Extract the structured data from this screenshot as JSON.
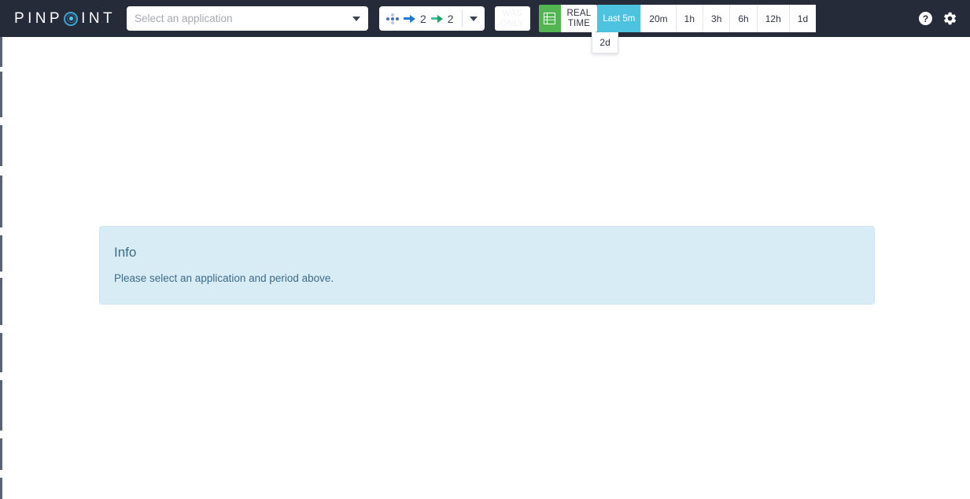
{
  "header": {
    "brand": {
      "prefix": "PINP",
      "o_icon": "pinpoint-target-icon",
      "suffix": "INT"
    },
    "app_select": {
      "placeholder": "Select an application",
      "value": "",
      "caret_icon": "caret-down-icon"
    },
    "node_summary": {
      "nodes_icon": "server-nodes-icon",
      "inbound_icon": "arrow-right-blue-icon",
      "inbound_count": "2",
      "outbound_icon": "arrow-right-green-icon",
      "outbound_count": "2",
      "caret_icon": "caret-down-icon"
    },
    "was_only": {
      "line1": "WAS",
      "line2": "ONLY",
      "disabled": true
    },
    "realtime": {
      "grid_icon": "grid-table-icon",
      "line1": "REAL",
      "line2": "TIME"
    },
    "periods": [
      {
        "label": "Last 5m",
        "active": true
      },
      {
        "label": "20m",
        "active": false
      },
      {
        "label": "1h",
        "active": false
      },
      {
        "label": "3h",
        "active": false
      },
      {
        "label": "6h",
        "active": false
      },
      {
        "label": "12h",
        "active": false
      },
      {
        "label": "1d",
        "active": false
      }
    ],
    "period_dropdown": {
      "open": true,
      "items": [
        {
          "label": "2d"
        }
      ]
    },
    "help_icon": "help-circle-icon",
    "help_glyph": "?",
    "settings_icon": "gear-icon"
  },
  "main": {
    "info": {
      "title": "Info",
      "message": "Please select an application and period above."
    }
  },
  "colors": {
    "header_bg": "#252b38",
    "accent_cyan": "#4ec3e0",
    "accent_green": "#52b552",
    "brand_ring": "#3ea6d6",
    "info_bg": "#d8ecf6",
    "info_text": "#3f6b85",
    "arrow_blue": "#1f78d1",
    "arrow_green": "#22a06b"
  }
}
